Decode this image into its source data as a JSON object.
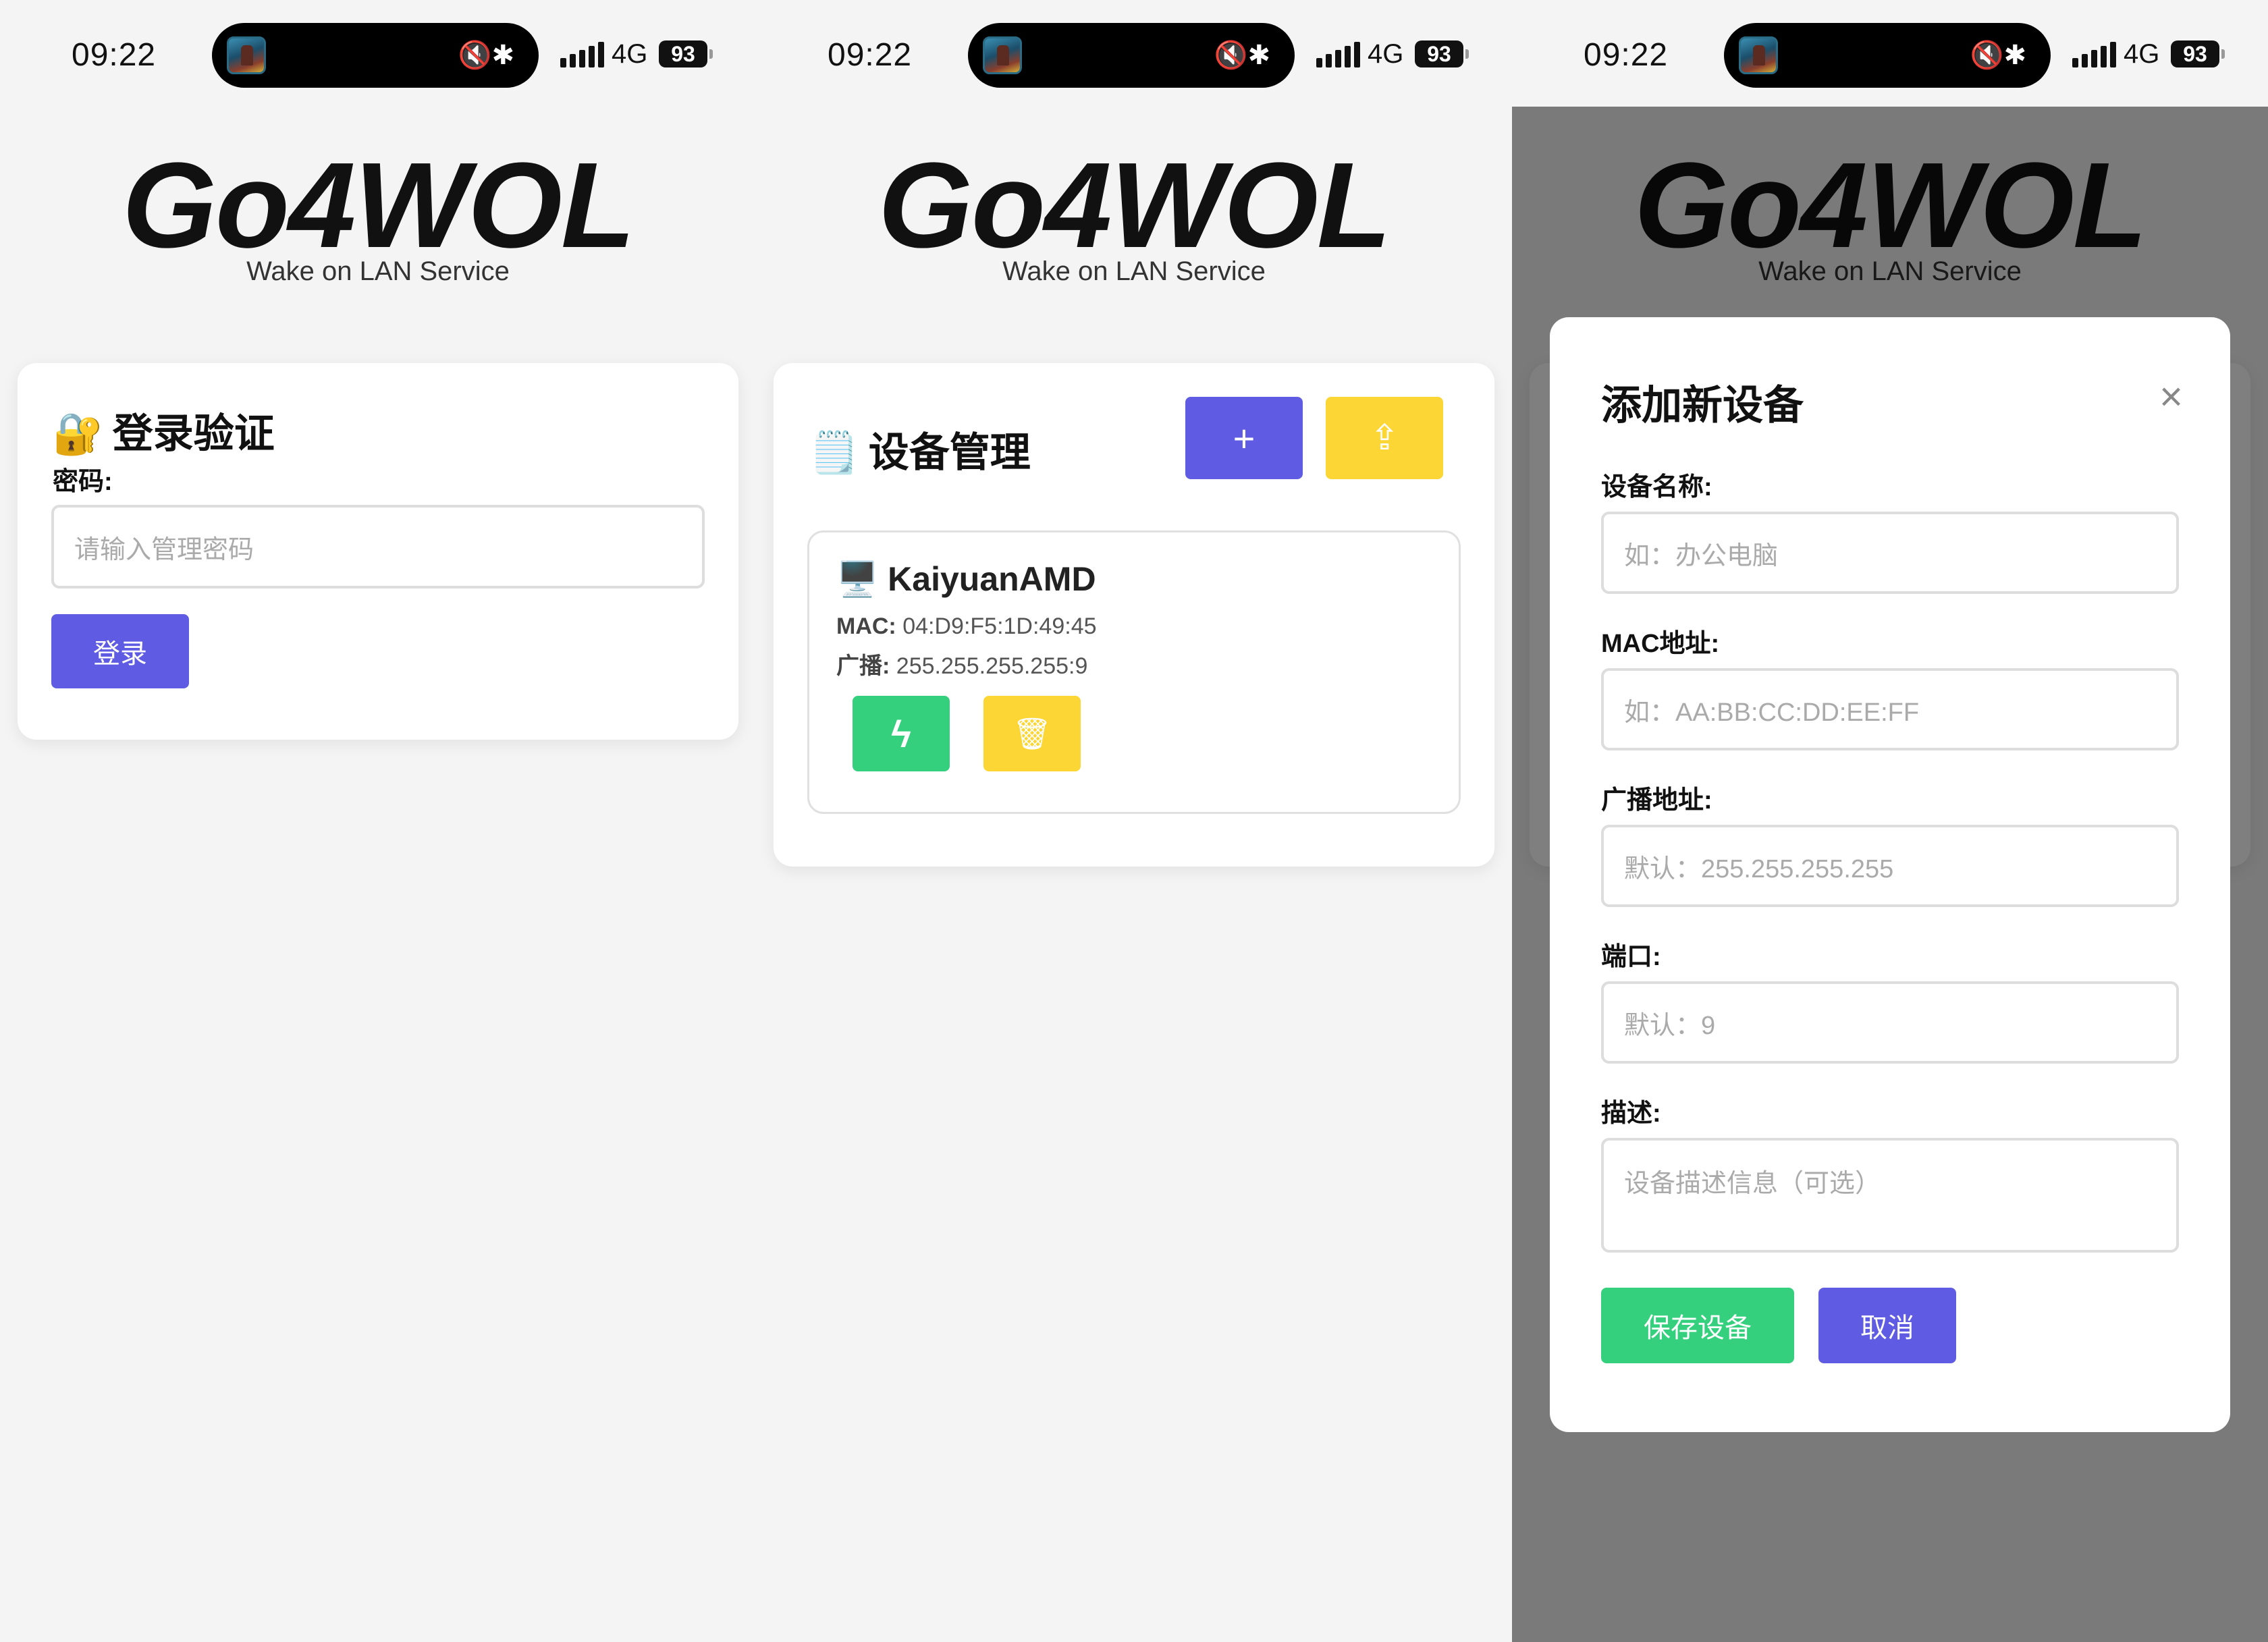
{
  "status": {
    "time": "09:22",
    "network": "4G",
    "battery": "93",
    "island_icons": "🔇✱"
  },
  "brand": {
    "logo": "Go4WOL",
    "tagline": "Wake on LAN Service"
  },
  "login": {
    "emoji": "🔐",
    "title": "登录验证",
    "password_label": "密码:",
    "password_placeholder": "请输入管理密码",
    "login_button": "登录"
  },
  "devices": {
    "emoji": "🗒️",
    "title": "设备管理",
    "add_button": "+",
    "upload_button": "⇪",
    "items": [
      {
        "icon": "🖥️",
        "name": "KaiyuanAMD",
        "mac_label": "MAC:",
        "mac": "04:D9:F5:1D:49:45",
        "broadcast_label": "广播:",
        "broadcast": "255.255.255.255:9",
        "wake_icon": "ϟ",
        "delete_icon": "🗑"
      }
    ]
  },
  "modal": {
    "title": "添加新设备",
    "close": "×",
    "name_label": "设备名称:",
    "name_placeholder": "如：办公电脑",
    "mac_label": "MAC地址:",
    "mac_placeholder": "如：AA:BB:CC:DD:EE:FF",
    "broadcast_label": "广播地址:",
    "broadcast_placeholder": "默认：255.255.255.255",
    "port_label": "端口:",
    "port_placeholder": "默认：9",
    "desc_label": "描述:",
    "desc_placeholder": "设备描述信息（可选）",
    "save_button": "保存设备",
    "cancel_button": "取消"
  },
  "colors": {
    "purple": "#5f5ce3",
    "yellow": "#fcd634",
    "green": "#35d07d"
  }
}
